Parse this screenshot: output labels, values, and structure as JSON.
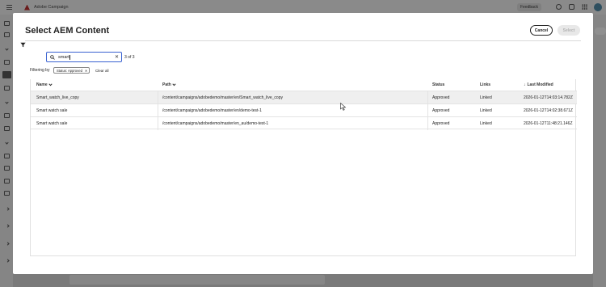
{
  "app": {
    "title": "Adobe Campaign",
    "feedback_label": "Feedback",
    "icons": [
      "hamburger-icon",
      "adobe-logo-icon",
      "help-icon",
      "bell-icon",
      "apps-grid-icon",
      "avatar"
    ]
  },
  "modal": {
    "title": "Select AEM Content",
    "cancel_label": "Cancel",
    "select_label": "Select",
    "search": {
      "value": "smart",
      "clear_glyph": "✕"
    },
    "result_count": "3 of 3",
    "filter_label": "Filtering by",
    "filter_tag": "Status: Approved",
    "clear_all_label": "Clear all",
    "columns": {
      "name": "Name",
      "path": "Path",
      "status": "Status",
      "links": "Links",
      "last_modified": "Last Modified"
    },
    "rows": [
      {
        "name": "Smart_watch_live_copy",
        "path": "/content/campaigns/adobedemo/master/en/Smart_watch_live_copy",
        "status": "Approved",
        "links": "Linked",
        "modified": "2026-01-12T14:03:14.782Z"
      },
      {
        "name": "Smart watch sale",
        "path": "/content/campaigns/adobedemo/master/en/demo-test-1",
        "status": "Approved",
        "links": "Linked",
        "modified": "2026-01-12T14:02:38.671Z"
      },
      {
        "name": "Smart watch sale",
        "path": "/content/campaigns/adobedemo/master/en_au/demo-test-1",
        "status": "Approved",
        "links": "Linked",
        "modified": "2026-01-12T11:48:21.146Z"
      }
    ]
  },
  "colors": {
    "accent": "#3b63d1",
    "overlay": "#7a7a7a",
    "hover_row": "#efefef"
  }
}
